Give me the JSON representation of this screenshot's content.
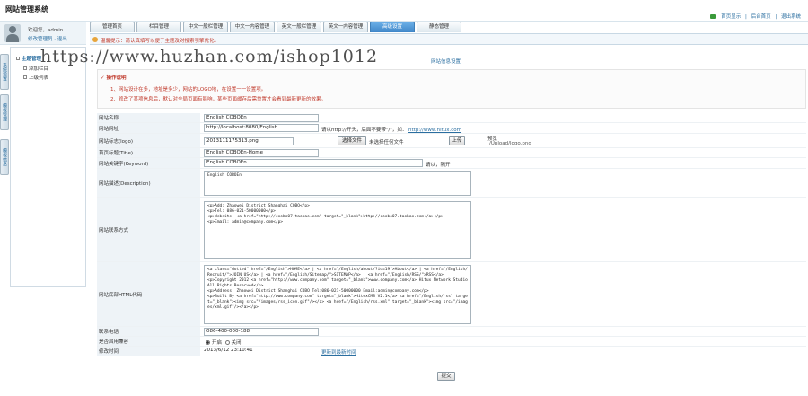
{
  "header": {
    "site_title": "网站管理系统",
    "links": [
      "首页显示",
      "后台首页",
      "退出系统"
    ]
  },
  "user": {
    "welcome": "欢迎您，admin",
    "links": "修改管理员 · 退出"
  },
  "tabs": [
    {
      "label": "管理首页",
      "active": false
    },
    {
      "label": "栏目管理",
      "active": false
    },
    {
      "label": "中文一般栏管理",
      "active": false
    },
    {
      "label": "中文一内容管理",
      "active": false
    },
    {
      "label": "英文一般栏管理",
      "active": false
    },
    {
      "label": "英文一内容管理",
      "active": false
    },
    {
      "label": "高级设置",
      "active": true
    },
    {
      "label": "静态管理",
      "active": false
    }
  ],
  "notice": "温馨提示：请认真填写以便于主题及对搜索引擎优化。",
  "left_tabs": [
    "系统设置",
    "模板管理",
    "模板信息"
  ],
  "sidebar": {
    "items": [
      "主题管理",
      "添加栏目",
      "上级列表"
    ]
  },
  "section_title": "网站信息设置",
  "operations": {
    "heading": "操作说明",
    "lines": [
      "1、网站设计在多，地址是多少，网站的LOGO地，在设置一一设置项。",
      "2、修改了某项信息后，默认对全局页面有影响，某些页面缓存后需重置才会看到最新更新的效果。"
    ]
  },
  "form": {
    "site_name": {
      "label": "网站名称",
      "value": "English COBOEn"
    },
    "site_url": {
      "label": "网站网址",
      "value": "http://localhost:8080/English",
      "hint": "请以http://开头，后面不要带\"/\"，如：",
      "hint_link": "http://www.hitux.com"
    },
    "logo": {
      "label": "网站标志(logo)",
      "value": "2013111175313.png",
      "choose_btn": "选择文件",
      "file_status": "未选择任何文件",
      "upload_btn": "上传",
      "preview_text": "/Upload/logo.png",
      "preview_label": "预览"
    },
    "title": {
      "label": "首页标题(Title)",
      "value": "English COBOEn-Home"
    },
    "keywords": {
      "label": "网站关键字(Keyword)",
      "value": "English COBOEn",
      "hint": "请以，隔开"
    },
    "description": {
      "label": "网站描述(Description)",
      "value": "English COBOEn"
    },
    "contact": {
      "label": "网站联系方式",
      "value": "<p>Add: Zhaowei District Shanghai COBO</p>\n<p>Tel: 086-021-50000000</p>\n<p>Website: <a href=\"http://coobo07.taobao.com\" target=\"_blank\">http://coobo07.taobao.com</a></p>\n<p>Email: admin@company.com</p>"
    },
    "footer_html": {
      "label": "网站底部HTML代码",
      "value": "<a class=\"dotted\" href=\"/English\">HOME</a> | <a href=\"/English/about/?id=19\">About</a> | <a href=\"/English/Recruit/\">JOIN US</a> | <a href=\"/English/Sitemap/\">SITEMAP</a> | <a href=\"/English/RSS/\">RSS</a>\n<p>Copyright 2012 <a href=\"http://www.company.com\" target=\"_blank\">www.company.com</a> Hitux Network Studio All Rights Reserved</p>\n<p>Address: Zhaowei District Shanghai COBO Tel:086-021-50000000 Email:admin@company.com</p>\n<p>Built By <a href=\"http://www.company.com\" target=\"_blank\">HitoxCMS V2.1</a> <a href=\"/English/rss\" target=\"_blank\"><img src=\"/images/rss_icon.gif\"/></a> <a href=\"/English/rss.xml\" target=\"_blank\"><img src=\"/images/xml.gif\"/></a></p>"
    },
    "phone": {
      "label": "联系电话",
      "value": "086-400-000-188"
    },
    "compat": {
      "label": "是否启用兼容",
      "opt_on": "开启",
      "opt_off": "关闭",
      "selected": "开启"
    },
    "modified": {
      "label": "修改时间",
      "value": "2013/6/12 23:10:41",
      "link": "更新到最新时间"
    },
    "submit": "提交"
  },
  "watermark": "https://www.huzhan.com/ishop1012"
}
